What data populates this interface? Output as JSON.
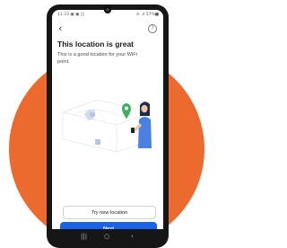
{
  "status_bar": {
    "time": "11:33",
    "notification_icons": "▣ ▣ ◫",
    "system_text": "⁂ .il 57%■"
  },
  "icons": {
    "back": "‹",
    "help": "?",
    "nav_recents": "|||",
    "nav_home": "○",
    "nav_back": "‹"
  },
  "page": {
    "title": "This location is great",
    "subtitle": "This is a good location for your WiFi point."
  },
  "buttons": {
    "secondary_label": "Try new location",
    "primary_label": "Next"
  },
  "colors": {
    "accent_orange": "#ec6a2e",
    "primary_blue": "#1a63e8",
    "pin_green": "#3fae5d"
  }
}
